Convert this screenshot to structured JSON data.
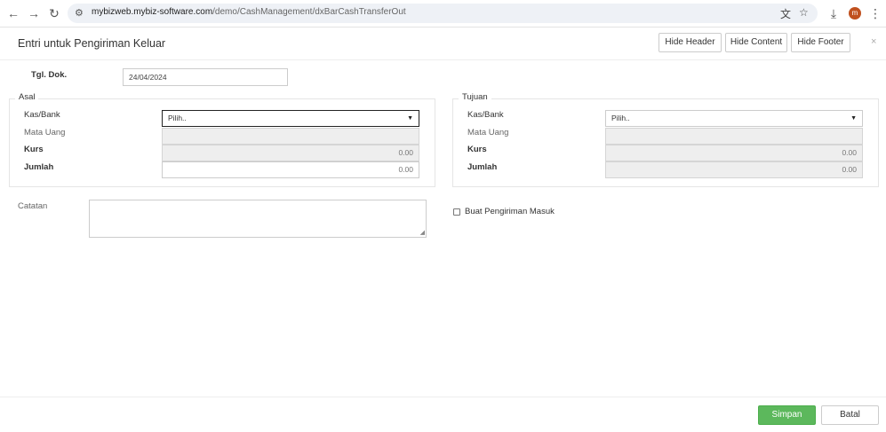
{
  "browser": {
    "url_host": "mybizweb.mybiz-software.com",
    "url_path": "/demo/CashManagement/dxBarCashTransferOut",
    "avatar_letter": "m",
    "icons": [
      "back-arrow-icon",
      "forward-arrow-icon",
      "reload-icon",
      "site-settings-icon",
      "translate-icon",
      "star-icon",
      "download-icon",
      "more-vert-icon"
    ]
  },
  "modal": {
    "title": "Entri untuk Pengiriman Keluar",
    "hide_header": "Hide Header",
    "hide_content": "Hide Content",
    "hide_footer": "Hide Footer",
    "close": "×"
  },
  "form": {
    "tgl_dok_label": "Tgl. Dok.",
    "tgl_dok_value": "24/04/2024",
    "asal": {
      "legend": "Asal",
      "kas_bank_label": "Kas/Bank",
      "kas_bank_value": "Pilih..",
      "mata_uang_label": "Mata Uang",
      "mata_uang_value": "",
      "kurs_label": "Kurs",
      "kurs_value": "0.00",
      "jumlah_label": "Jumlah",
      "jumlah_value": "0.00"
    },
    "tujuan": {
      "legend": "Tujuan",
      "kas_bank_label": "Kas/Bank",
      "kas_bank_value": "Pilih..",
      "mata_uang_label": "Mata Uang",
      "mata_uang_value": "",
      "kurs_label": "Kurs",
      "kurs_value": "0.00",
      "jumlah_label": "Jumlah",
      "jumlah_value": "0.00"
    },
    "catatan_label": "Catatan",
    "catatan_value": "",
    "buat_pengiriman_label": "Buat Pengiriman Masuk",
    "buat_pengiriman_checked": false
  },
  "footer": {
    "save": "Simpan",
    "cancel": "Batal"
  },
  "colors": {
    "primary": "#5cb85c",
    "readonly_bg": "#eeeeee",
    "avatar": "#c0501e"
  }
}
